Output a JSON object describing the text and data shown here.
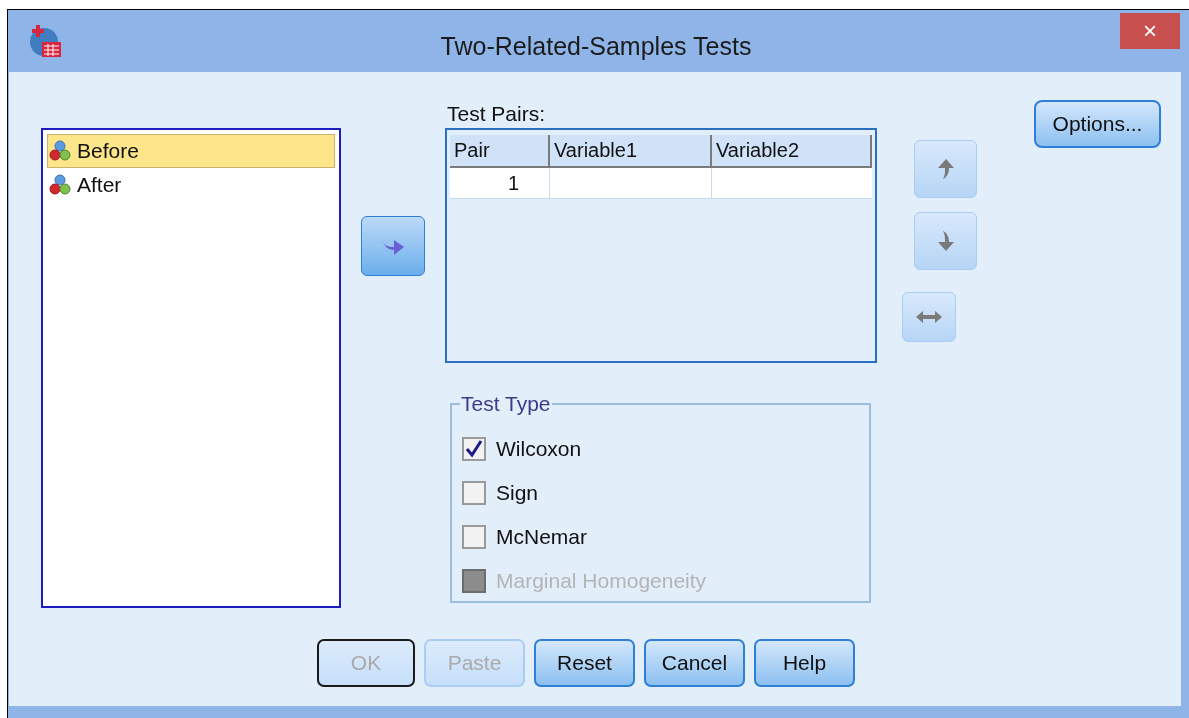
{
  "window": {
    "title": "Two-Related-Samples Tests",
    "close": "×"
  },
  "variables": [
    {
      "name": "Before",
      "selected": true
    },
    {
      "name": "After",
      "selected": false
    }
  ],
  "test_pairs": {
    "label": "Test Pairs:",
    "columns": [
      "Pair",
      "Variable1",
      "Variable2"
    ],
    "rows": [
      {
        "pair": "1"
      }
    ]
  },
  "options_button": "Options...",
  "test_type": {
    "title": "Test Type",
    "options": [
      {
        "label": "Wilcoxon",
        "checked": true,
        "disabled": false
      },
      {
        "label": "Sign",
        "checked": false,
        "disabled": false
      },
      {
        "label": "McNemar",
        "checked": false,
        "disabled": false
      },
      {
        "label": "Marginal Homogeneity",
        "checked": false,
        "disabled": true
      }
    ]
  },
  "buttons": [
    {
      "label": "OK",
      "disabled": true,
      "default": true
    },
    {
      "label": "Paste",
      "disabled": true,
      "default": false
    },
    {
      "label": "Reset",
      "disabled": false,
      "default": false
    },
    {
      "label": "Cancel",
      "disabled": false,
      "default": false
    },
    {
      "label": "Help",
      "disabled": false,
      "default": false
    }
  ]
}
